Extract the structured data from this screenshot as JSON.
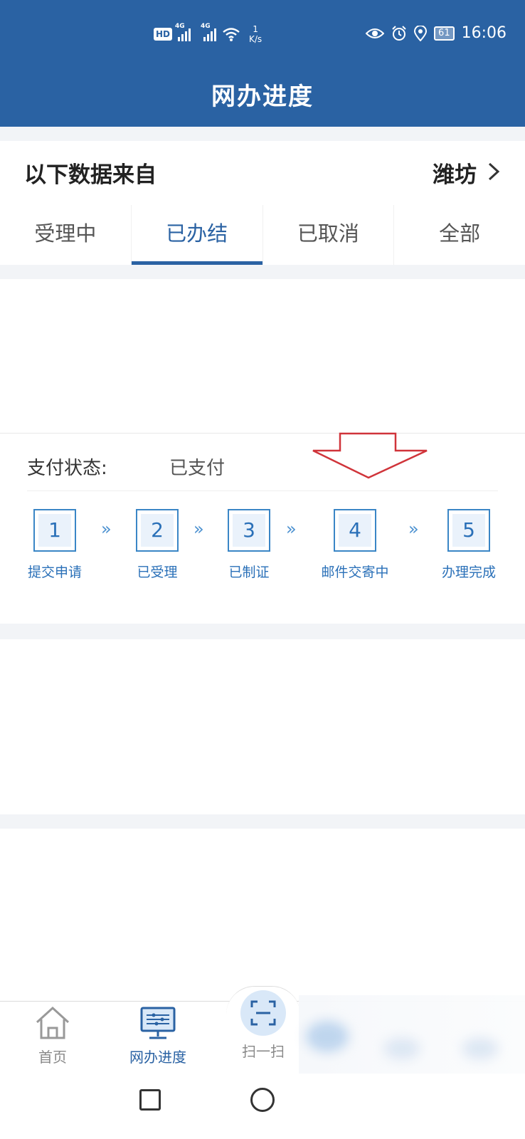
{
  "status_bar": {
    "hd_label": "HD",
    "signal_1": "4G",
    "signal_2": "4G",
    "speed_value": "1",
    "speed_unit": "K/s",
    "battery": "61",
    "time": "16:06"
  },
  "header": {
    "title": "网办进度"
  },
  "source": {
    "label": "以下数据来自",
    "city": "潍坊"
  },
  "tabs": [
    {
      "label": "受理中",
      "active": false
    },
    {
      "label": "已办结",
      "active": true
    },
    {
      "label": "已取消",
      "active": false
    },
    {
      "label": "全部",
      "active": false
    }
  ],
  "card": {
    "payment_label": "支付状态:",
    "payment_value": "已支付",
    "steps": [
      {
        "number": "1",
        "label": "提交申请"
      },
      {
        "number": "2",
        "label": "已受理"
      },
      {
        "number": "3",
        "label": "已制证"
      },
      {
        "number": "4",
        "label": "邮件交寄中"
      },
      {
        "number": "5",
        "label": "办理完成"
      }
    ],
    "step_separator": "»"
  },
  "bottom_nav": {
    "items": [
      {
        "label": "首页",
        "icon": "home-icon",
        "active": false
      },
      {
        "label": "网办进度",
        "icon": "progress-monitor-icon",
        "active": true
      },
      {
        "label": "扫一扫",
        "icon": "scan-icon",
        "active": false
      }
    ]
  },
  "colors": {
    "brand": "#2a62a3",
    "step_accent": "#3a86c6",
    "annotation_arrow": "#d0343a"
  }
}
